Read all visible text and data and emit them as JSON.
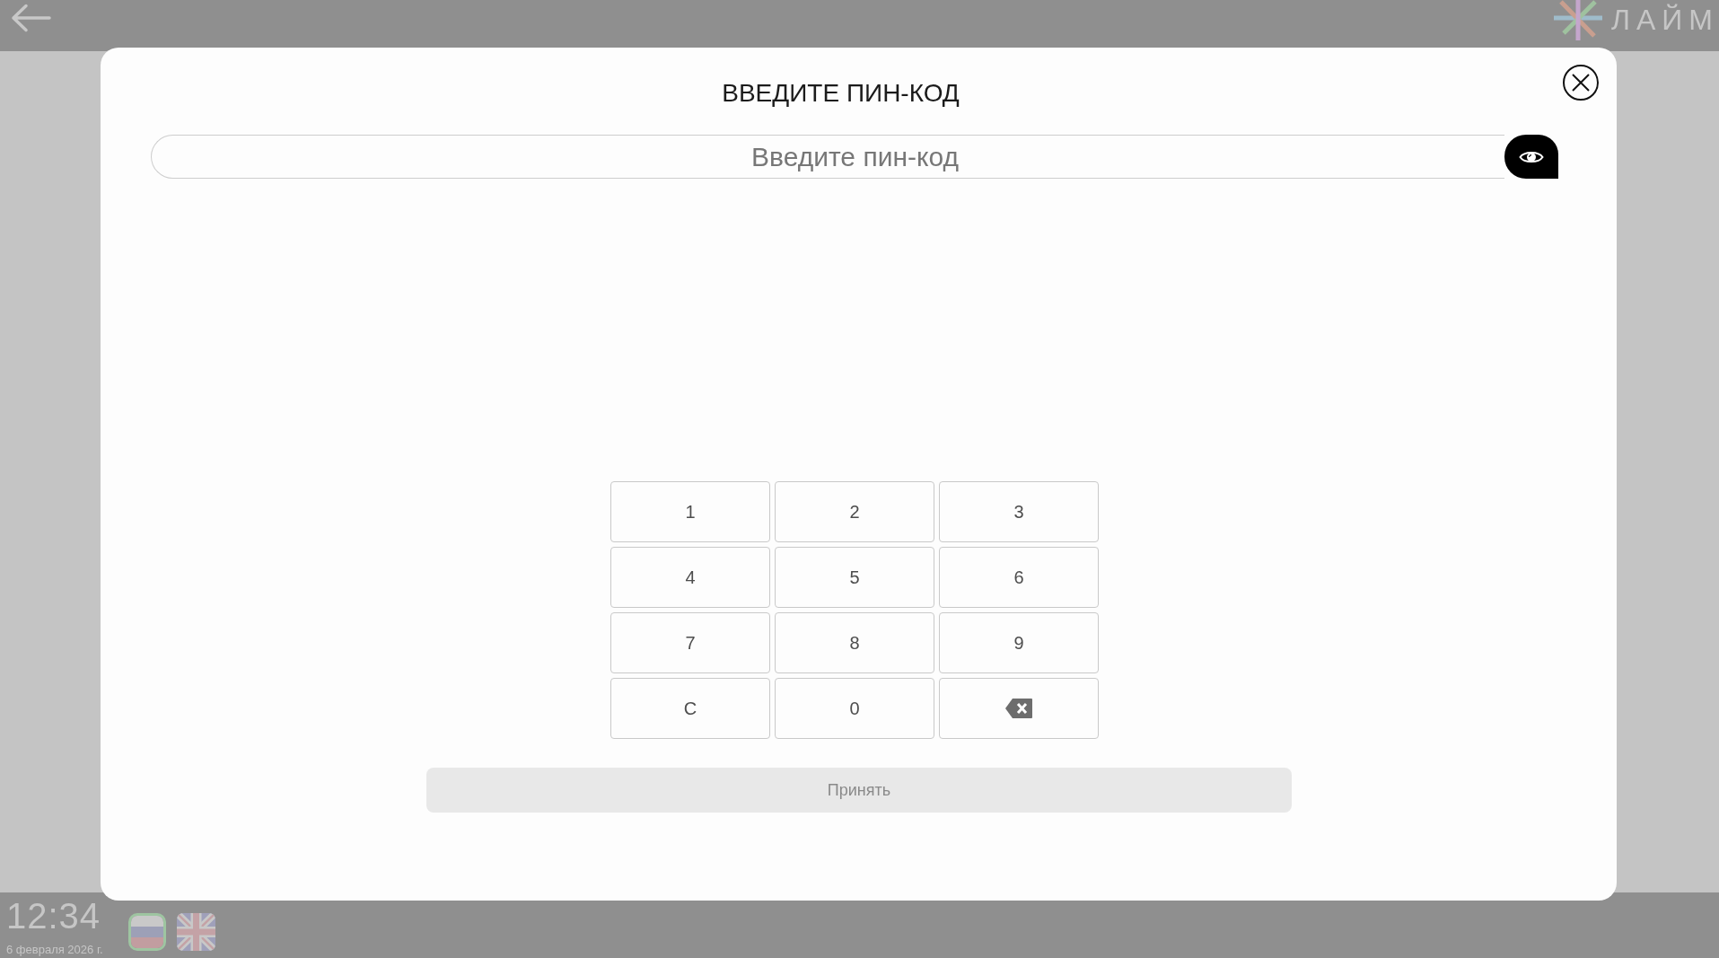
{
  "header": {
    "logo_text": "ЛАЙМ"
  },
  "dialog": {
    "title": "ВВЕДИТЕ ПИН-КОД",
    "pin_field": {
      "placeholder": "Введите пин-код"
    },
    "keypad": [
      {
        "kind": "key",
        "label": "1"
      },
      {
        "kind": "key",
        "label": "2"
      },
      {
        "kind": "key",
        "label": "3"
      },
      {
        "kind": "key",
        "label": "4"
      },
      {
        "kind": "key",
        "label": "5"
      },
      {
        "kind": "key",
        "label": "6"
      },
      {
        "kind": "key",
        "label": "7"
      },
      {
        "kind": "key",
        "label": "8"
      },
      {
        "kind": "key",
        "label": "9"
      },
      {
        "kind": "key",
        "label": "C"
      },
      {
        "kind": "key",
        "label": "0"
      },
      {
        "kind": "backspace"
      }
    ],
    "submit_button": {
      "label": "Принять",
      "disabled": true
    }
  },
  "footer": {
    "time": "12:34",
    "date": "6 февраля 2026 г.",
    "languages": [
      {
        "kind": "ru",
        "selected": true
      },
      {
        "kind": "en",
        "selected": false
      }
    ]
  }
}
